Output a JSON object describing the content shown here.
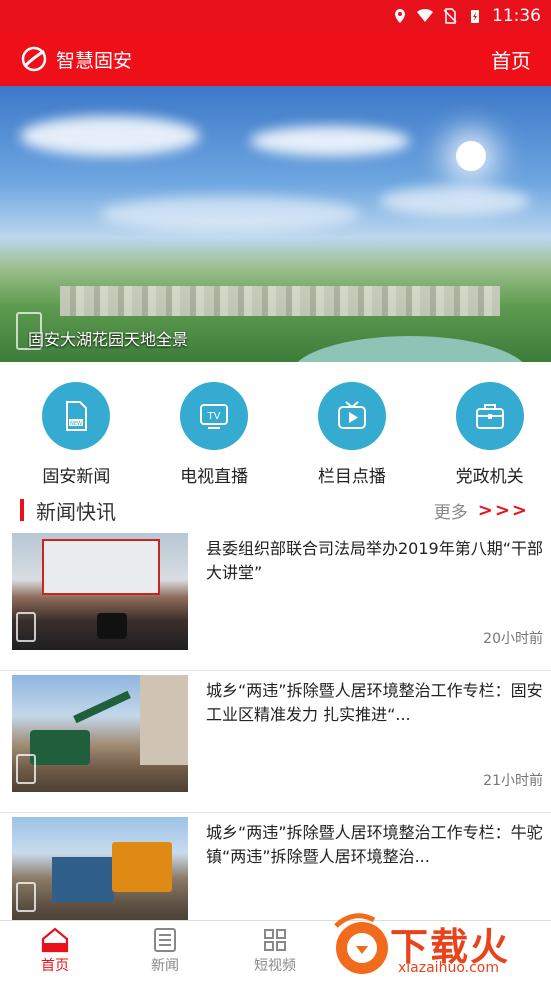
{
  "status": {
    "time": "11:36"
  },
  "app": {
    "title": "智慧固安",
    "home_link": "首页"
  },
  "banner": {
    "caption": "固安大湖花园天地全景"
  },
  "shortcuts": [
    {
      "label": "固安新闻",
      "icon": "news-file-icon"
    },
    {
      "label": "电视直播",
      "icon": "tv-icon"
    },
    {
      "label": "栏目点播",
      "icon": "video-play-icon"
    },
    {
      "label": "党政机关",
      "icon": "briefcase-icon"
    }
  ],
  "section": {
    "title": "新闻快讯",
    "more": "更多",
    "arrows": ">>>"
  },
  "news": [
    {
      "title": "县委组织部联合司法局举办2019年第八期“干部大讲堂”",
      "time": "20小时前"
    },
    {
      "title": "城乡“两违”拆除暨人居环境整治工作专栏：固安工业区精准发力 扎实推进“...",
      "time": "21小时前"
    },
    {
      "title": "城乡“两违”拆除暨人居环境整治工作专栏：牛驼镇“两违”拆除暨人居环境整治...",
      "time": ""
    }
  ],
  "tabs": [
    {
      "label": "首页",
      "active": true
    },
    {
      "label": "新闻",
      "active": false
    },
    {
      "label": "短视频",
      "active": false
    }
  ],
  "brand": {
    "name": "下载火",
    "url": "xiazaihuo.com"
  }
}
